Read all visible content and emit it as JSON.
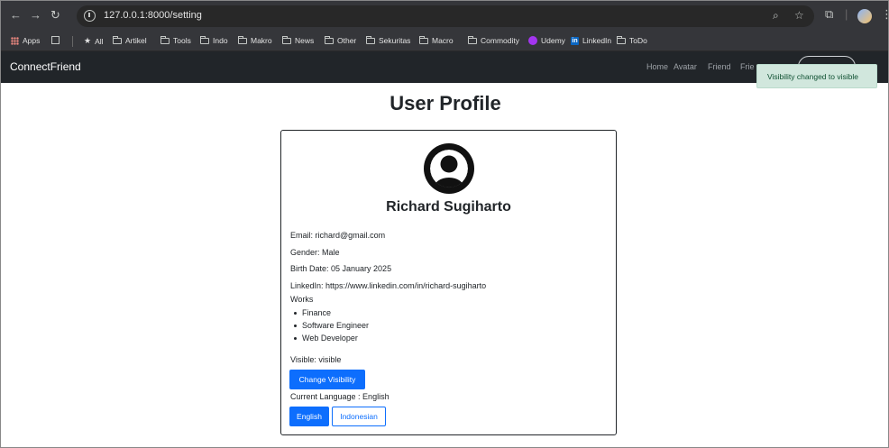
{
  "browser": {
    "url": "127.0.0.1:8000/setting",
    "bookmarks": [
      {
        "label": "Apps",
        "icon": "apps-icon"
      },
      {
        "label": "All",
        "icon": "star-icon"
      },
      {
        "label": "Artikel",
        "icon": "folder-icon"
      },
      {
        "label": "Tools",
        "icon": "folder-icon"
      },
      {
        "label": "Indo",
        "icon": "folder-icon"
      },
      {
        "label": "Makro",
        "icon": "folder-icon"
      },
      {
        "label": "News",
        "icon": "folder-icon"
      },
      {
        "label": "Other",
        "icon": "folder-icon"
      },
      {
        "label": "Sekuritas",
        "icon": "folder-icon"
      },
      {
        "label": "Macro",
        "icon": "folder-icon"
      },
      {
        "label": "Commodity",
        "icon": "folder-icon"
      },
      {
        "label": "Udemy",
        "icon": "udemy-icon"
      },
      {
        "label": "LinkedIn",
        "icon": "linkedin-icon"
      },
      {
        "label": "ToDo",
        "icon": "folder-icon"
      }
    ]
  },
  "navbar": {
    "brand": "ConnectFriend",
    "links": [
      "Home",
      "Avatar",
      "Friend",
      "Frie"
    ]
  },
  "toast": {
    "message": "Visibility changed to visible"
  },
  "profile": {
    "page_title": "User Profile",
    "name": "Richard Sugiharto",
    "email": "Email: richard@gmail.com",
    "gender": "Gender: Male",
    "birth_date": "Birth Date: 05 January 2025",
    "linkedin": "LinkedIn: https://www.linkedin.com/in/richard-sugiharto",
    "works_label": "Works",
    "works": [
      "Finance",
      "Software Engineer",
      "Web Developer"
    ],
    "visible": "Visible: visible",
    "change_visibility_label": "Change Visibility",
    "current_language": "Current Language : English",
    "language_options": [
      "English",
      "Indonesian"
    ]
  },
  "colors": {
    "primary": "#0d6efd",
    "navbar_bg": "#212529",
    "toast_bg": "#d1e7dd",
    "chrome_bg": "#35363a"
  }
}
